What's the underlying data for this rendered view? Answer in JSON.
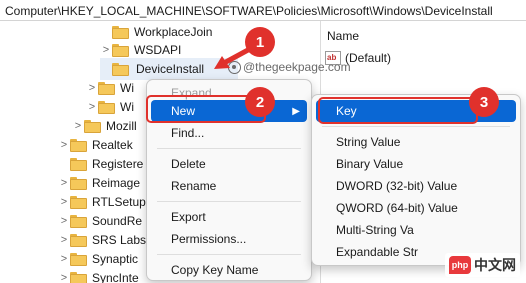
{
  "address_bar": {
    "path": "Computer\\HKEY_LOCAL_MACHINE\\SOFTWARE\\Policies\\Microsoft\\Windows\\DeviceInstall"
  },
  "tree": {
    "items": [
      {
        "label": "WorkplaceJoin",
        "chevron": ""
      },
      {
        "label": "WSDAPI",
        "chevron": ">"
      },
      {
        "label": "DeviceInstall",
        "chevron": ""
      },
      {
        "label": "Wi",
        "chevron": ">"
      },
      {
        "label": "Wi",
        "chevron": ">"
      },
      {
        "label": "Mozill",
        "chevron": ">"
      },
      {
        "label": "Realtek",
        "chevron": ">"
      },
      {
        "label": "Registere",
        "chevron": ""
      },
      {
        "label": "Reimage",
        "chevron": ">"
      },
      {
        "label": "RTLSetup",
        "chevron": ">"
      },
      {
        "label": "SoundRe",
        "chevron": ">"
      },
      {
        "label": "SRS Labs",
        "chevron": ">"
      },
      {
        "label": "Synaptic",
        "chevron": ">"
      },
      {
        "label": "SyncInte",
        "chevron": ">"
      }
    ]
  },
  "values_pane": {
    "header": "Name",
    "default_icon_text": "ab",
    "default_value_name": "(Default)"
  },
  "watermark": "@thegeekpage.com",
  "context_menu": {
    "items": {
      "expand": "Expand",
      "new": "New",
      "find": "Find...",
      "delete": "Delete",
      "rename": "Rename",
      "export": "Export",
      "permissions": "Permissions...",
      "copy_key_name": "Copy Key Name"
    }
  },
  "submenu": {
    "items": {
      "key": "Key",
      "string": "String Value",
      "binary": "Binary Value",
      "dword": "DWORD (32-bit) Value",
      "qword": "QWORD (64-bit) Value",
      "multi": "Multi-String Va",
      "expandable": "Expandable Str"
    }
  },
  "annotations": {
    "badge1": "1",
    "badge2": "2",
    "badge3": "3",
    "color": "#e0312c"
  },
  "corner_logo": {
    "logo": "php",
    "text": "中文网"
  },
  "colors": {
    "highlight": "#0a67d4",
    "folder": "#f5c85a"
  }
}
